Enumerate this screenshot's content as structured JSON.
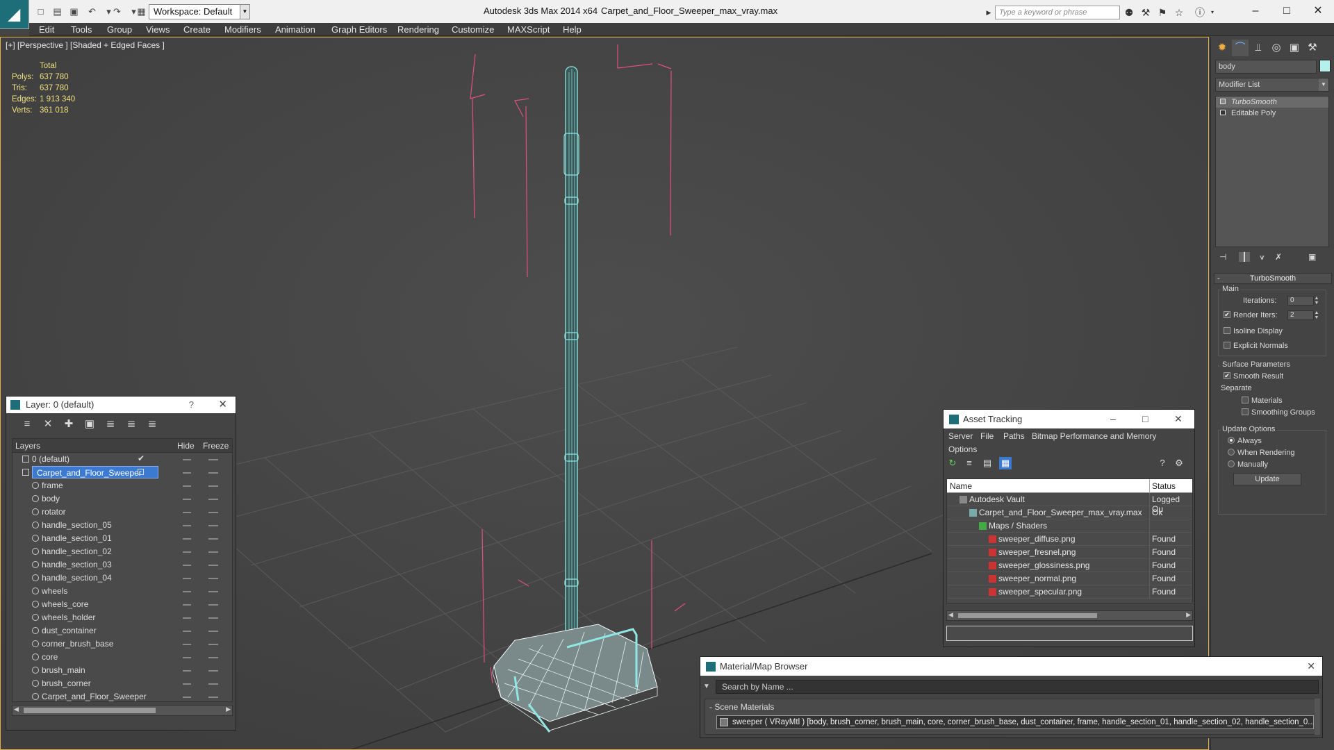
{
  "titlebar": {
    "workspace": "Workspace: Default",
    "app_title": "Autodesk 3ds Max  2014 x64",
    "file_title": "Carpet_and_Floor_Sweeper_max_vray.max",
    "search_placeholder": "Type a keyword or phrase"
  },
  "menu": [
    "Edit",
    "Tools",
    "Group",
    "Views",
    "Create",
    "Modifiers",
    "Animation",
    "Graph Editors",
    "Rendering",
    "Customize",
    "MAXScript",
    "Help"
  ],
  "viewport": {
    "label": "[+] [Perspective ] [Shaded + Edged Faces ]",
    "stats_header": "Total",
    "stats": [
      {
        "label": "Polys:",
        "value": "637 780"
      },
      {
        "label": "Tris:",
        "value": "637 780"
      },
      {
        "label": "Edges:",
        "value": "1 913 340"
      },
      {
        "label": "Verts:",
        "value": "361 018"
      }
    ]
  },
  "layer_panel": {
    "title": "Layer: 0 (default)",
    "help": "?",
    "col_layers": "Layers",
    "col_hide": "Hide",
    "col_freeze": "Freeze",
    "rows": [
      {
        "name": "0 (default)",
        "level": 0
      },
      {
        "name": "Carpet_and_Floor_Sweeper",
        "level": 0
      },
      {
        "name": "frame",
        "level": 1
      },
      {
        "name": "body",
        "level": 1
      },
      {
        "name": "rotator",
        "level": 1
      },
      {
        "name": "handle_section_05",
        "level": 1
      },
      {
        "name": "handle_section_01",
        "level": 1
      },
      {
        "name": "handle_section_02",
        "level": 1
      },
      {
        "name": "handle_section_03",
        "level": 1
      },
      {
        "name": "handle_section_04",
        "level": 1
      },
      {
        "name": "wheels",
        "level": 1
      },
      {
        "name": "wheels_core",
        "level": 1
      },
      {
        "name": "wheels_holder",
        "level": 1
      },
      {
        "name": "dust_container",
        "level": 1
      },
      {
        "name": "corner_brush_base",
        "level": 1
      },
      {
        "name": "core",
        "level": 1
      },
      {
        "name": "brush_main",
        "level": 1
      },
      {
        "name": "brush_corner",
        "level": 1
      },
      {
        "name": "Carpet_and_Floor_Sweeper",
        "level": 1
      }
    ],
    "selected_row": 1
  },
  "command_panel": {
    "object_name": "body",
    "object_color": "#b4f0ec",
    "modifier_list": "Modifier List",
    "stack": [
      "TurboSmooth",
      "Editable Poly"
    ],
    "turbosmooth": {
      "title": "TurboSmooth",
      "main_group": "Main",
      "iterations_label": "Iterations:",
      "iterations_value": "0",
      "render_iters_label": "Render Iters:",
      "render_iters_value": "2",
      "render_iters_checked": true,
      "isoline_label": "Isoline Display",
      "explicit_normals_label": "Explicit Normals",
      "surface_group": "Surface Parameters",
      "smooth_result_label": "Smooth Result",
      "separate_label": "Separate",
      "materials_label": "Materials",
      "smoothing_groups_label": "Smoothing Groups",
      "update_group": "Update Options",
      "always_label": "Always",
      "when_rendering_label": "When Rendering",
      "manually_label": "Manually",
      "update_button": "Update"
    }
  },
  "asset_tracking": {
    "title": "Asset Tracking",
    "menu": [
      "Server",
      "File",
      "Paths",
      "Bitmap Performance and Memory",
      "Options"
    ],
    "col_name": "Name",
    "col_status": "Status",
    "rows": [
      {
        "name": "Autodesk Vault",
        "status": "Logged Ou",
        "indent": 1
      },
      {
        "name": "Carpet_and_Floor_Sweeper_max_vray.max",
        "status": "Ok",
        "indent": 2
      },
      {
        "name": "Maps / Shaders",
        "status": "",
        "indent": 3
      },
      {
        "name": "sweeper_diffuse.png",
        "status": "Found",
        "indent": 4
      },
      {
        "name": "sweeper_fresnel.png",
        "status": "Found",
        "indent": 4
      },
      {
        "name": "sweeper_glossiness.png",
        "status": "Found",
        "indent": 4
      },
      {
        "name": "sweeper_normal.png",
        "status": "Found",
        "indent": 4
      },
      {
        "name": "sweeper_specular.png",
        "status": "Found",
        "indent": 4
      }
    ]
  },
  "material_browser": {
    "title": "Material/Map Browser",
    "search_placeholder": "Search by Name ...",
    "section": "- Scene Materials",
    "entry": "sweeper  ( VRayMtl ) [body, brush_corner, brush_main, core, corner_brush_base, dust_container, frame, handle_section_01, handle_section_02, handle_section_0..."
  }
}
